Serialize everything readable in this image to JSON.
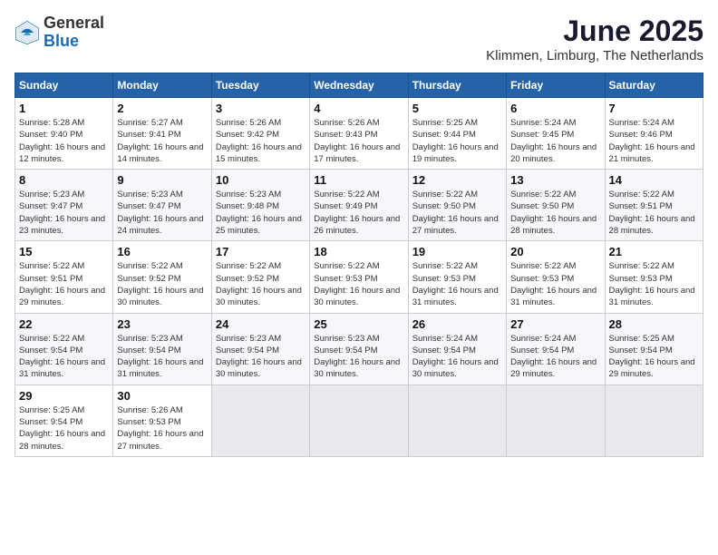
{
  "header": {
    "logo": {
      "general": "General",
      "blue": "Blue"
    },
    "title": "June 2025",
    "subtitle": "Klimmen, Limburg, The Netherlands"
  },
  "calendar": {
    "weekdays": [
      "Sunday",
      "Monday",
      "Tuesday",
      "Wednesday",
      "Thursday",
      "Friday",
      "Saturday"
    ],
    "weeks": [
      [
        {
          "day": "1",
          "sunrise": "Sunrise: 5:28 AM",
          "sunset": "Sunset: 9:40 PM",
          "daylight": "Daylight: 16 hours and 12 minutes."
        },
        {
          "day": "2",
          "sunrise": "Sunrise: 5:27 AM",
          "sunset": "Sunset: 9:41 PM",
          "daylight": "Daylight: 16 hours and 14 minutes."
        },
        {
          "day": "3",
          "sunrise": "Sunrise: 5:26 AM",
          "sunset": "Sunset: 9:42 PM",
          "daylight": "Daylight: 16 hours and 15 minutes."
        },
        {
          "day": "4",
          "sunrise": "Sunrise: 5:26 AM",
          "sunset": "Sunset: 9:43 PM",
          "daylight": "Daylight: 16 hours and 17 minutes."
        },
        {
          "day": "5",
          "sunrise": "Sunrise: 5:25 AM",
          "sunset": "Sunset: 9:44 PM",
          "daylight": "Daylight: 16 hours and 19 minutes."
        },
        {
          "day": "6",
          "sunrise": "Sunrise: 5:24 AM",
          "sunset": "Sunset: 9:45 PM",
          "daylight": "Daylight: 16 hours and 20 minutes."
        },
        {
          "day": "7",
          "sunrise": "Sunrise: 5:24 AM",
          "sunset": "Sunset: 9:46 PM",
          "daylight": "Daylight: 16 hours and 21 minutes."
        }
      ],
      [
        {
          "day": "8",
          "sunrise": "Sunrise: 5:23 AM",
          "sunset": "Sunset: 9:47 PM",
          "daylight": "Daylight: 16 hours and 23 minutes."
        },
        {
          "day": "9",
          "sunrise": "Sunrise: 5:23 AM",
          "sunset": "Sunset: 9:47 PM",
          "daylight": "Daylight: 16 hours and 24 minutes."
        },
        {
          "day": "10",
          "sunrise": "Sunrise: 5:23 AM",
          "sunset": "Sunset: 9:48 PM",
          "daylight": "Daylight: 16 hours and 25 minutes."
        },
        {
          "day": "11",
          "sunrise": "Sunrise: 5:22 AM",
          "sunset": "Sunset: 9:49 PM",
          "daylight": "Daylight: 16 hours and 26 minutes."
        },
        {
          "day": "12",
          "sunrise": "Sunrise: 5:22 AM",
          "sunset": "Sunset: 9:50 PM",
          "daylight": "Daylight: 16 hours and 27 minutes."
        },
        {
          "day": "13",
          "sunrise": "Sunrise: 5:22 AM",
          "sunset": "Sunset: 9:50 PM",
          "daylight": "Daylight: 16 hours and 28 minutes."
        },
        {
          "day": "14",
          "sunrise": "Sunrise: 5:22 AM",
          "sunset": "Sunset: 9:51 PM",
          "daylight": "Daylight: 16 hours and 28 minutes."
        }
      ],
      [
        {
          "day": "15",
          "sunrise": "Sunrise: 5:22 AM",
          "sunset": "Sunset: 9:51 PM",
          "daylight": "Daylight: 16 hours and 29 minutes."
        },
        {
          "day": "16",
          "sunrise": "Sunrise: 5:22 AM",
          "sunset": "Sunset: 9:52 PM",
          "daylight": "Daylight: 16 hours and 30 minutes."
        },
        {
          "day": "17",
          "sunrise": "Sunrise: 5:22 AM",
          "sunset": "Sunset: 9:52 PM",
          "daylight": "Daylight: 16 hours and 30 minutes."
        },
        {
          "day": "18",
          "sunrise": "Sunrise: 5:22 AM",
          "sunset": "Sunset: 9:53 PM",
          "daylight": "Daylight: 16 hours and 30 minutes."
        },
        {
          "day": "19",
          "sunrise": "Sunrise: 5:22 AM",
          "sunset": "Sunset: 9:53 PM",
          "daylight": "Daylight: 16 hours and 31 minutes."
        },
        {
          "day": "20",
          "sunrise": "Sunrise: 5:22 AM",
          "sunset": "Sunset: 9:53 PM",
          "daylight": "Daylight: 16 hours and 31 minutes."
        },
        {
          "day": "21",
          "sunrise": "Sunrise: 5:22 AM",
          "sunset": "Sunset: 9:53 PM",
          "daylight": "Daylight: 16 hours and 31 minutes."
        }
      ],
      [
        {
          "day": "22",
          "sunrise": "Sunrise: 5:22 AM",
          "sunset": "Sunset: 9:54 PM",
          "daylight": "Daylight: 16 hours and 31 minutes."
        },
        {
          "day": "23",
          "sunrise": "Sunrise: 5:23 AM",
          "sunset": "Sunset: 9:54 PM",
          "daylight": "Daylight: 16 hours and 31 minutes."
        },
        {
          "day": "24",
          "sunrise": "Sunrise: 5:23 AM",
          "sunset": "Sunset: 9:54 PM",
          "daylight": "Daylight: 16 hours and 30 minutes."
        },
        {
          "day": "25",
          "sunrise": "Sunrise: 5:23 AM",
          "sunset": "Sunset: 9:54 PM",
          "daylight": "Daylight: 16 hours and 30 minutes."
        },
        {
          "day": "26",
          "sunrise": "Sunrise: 5:24 AM",
          "sunset": "Sunset: 9:54 PM",
          "daylight": "Daylight: 16 hours and 30 minutes."
        },
        {
          "day": "27",
          "sunrise": "Sunrise: 5:24 AM",
          "sunset": "Sunset: 9:54 PM",
          "daylight": "Daylight: 16 hours and 29 minutes."
        },
        {
          "day": "28",
          "sunrise": "Sunrise: 5:25 AM",
          "sunset": "Sunset: 9:54 PM",
          "daylight": "Daylight: 16 hours and 29 minutes."
        }
      ],
      [
        {
          "day": "29",
          "sunrise": "Sunrise: 5:25 AM",
          "sunset": "Sunset: 9:54 PM",
          "daylight": "Daylight: 16 hours and 28 minutes."
        },
        {
          "day": "30",
          "sunrise": "Sunrise: 5:26 AM",
          "sunset": "Sunset: 9:53 PM",
          "daylight": "Daylight: 16 hours and 27 minutes."
        },
        null,
        null,
        null,
        null,
        null
      ]
    ]
  }
}
